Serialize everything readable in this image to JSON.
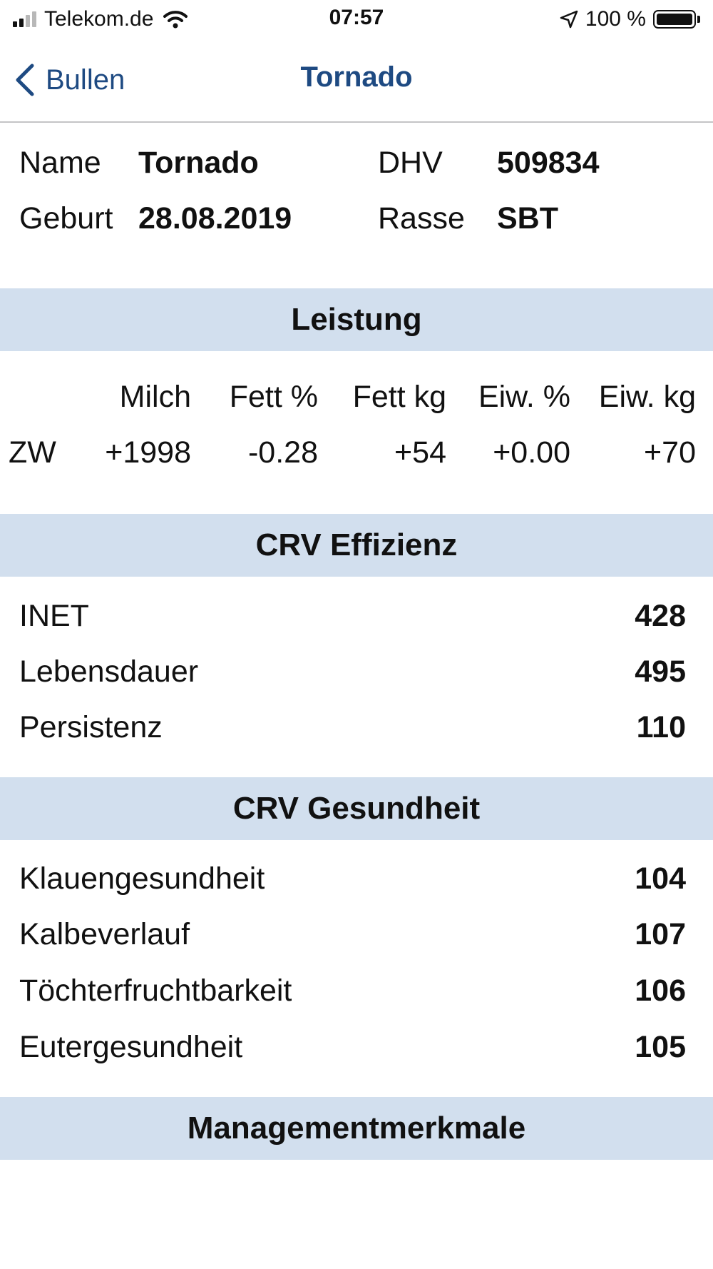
{
  "status_bar": {
    "carrier": "Telekom.de",
    "time": "07:57",
    "battery": "100 %",
    "icons": [
      "signal-icon",
      "wifi-icon",
      "location-arrow-icon",
      "battery-icon"
    ]
  },
  "nav": {
    "back_label": "Bullen",
    "title": "Tornado",
    "accent_color": "#1e4a82"
  },
  "info": {
    "name_label": "Name",
    "name_value": "Tornado",
    "dhv_label": "DHV",
    "dhv_value": "509834",
    "birth_label": "Geburt",
    "birth_value": "28.08.2019",
    "breed_label": "Rasse",
    "breed_value": "SBT"
  },
  "sections": {
    "performance": "Leistung",
    "efficiency": "CRV Effizienz",
    "health": "CRV Gesundheit",
    "management": "Managementmerkmale",
    "header_color": "#d2dfee"
  },
  "performance": {
    "columns": [
      "Milch",
      "Fett %",
      "Fett kg",
      "Eiw. %",
      "Eiw. kg"
    ],
    "row_label": "ZW",
    "values": [
      "+1998",
      "-0.28",
      "+54",
      "+0.00",
      "+70"
    ]
  },
  "efficiency": [
    {
      "label": "INET",
      "value": "428"
    },
    {
      "label": "Lebensdauer",
      "value": "495"
    },
    {
      "label": "Persistenz",
      "value": "110"
    }
  ],
  "health": [
    {
      "label": "Klauengesundheit",
      "value": "104"
    },
    {
      "label": "Kalbeverlauf",
      "value": "107"
    },
    {
      "label": "Töchterfruchtbarkeit",
      "value": "106"
    },
    {
      "label": "Eutergesundheit",
      "value": "105"
    }
  ]
}
